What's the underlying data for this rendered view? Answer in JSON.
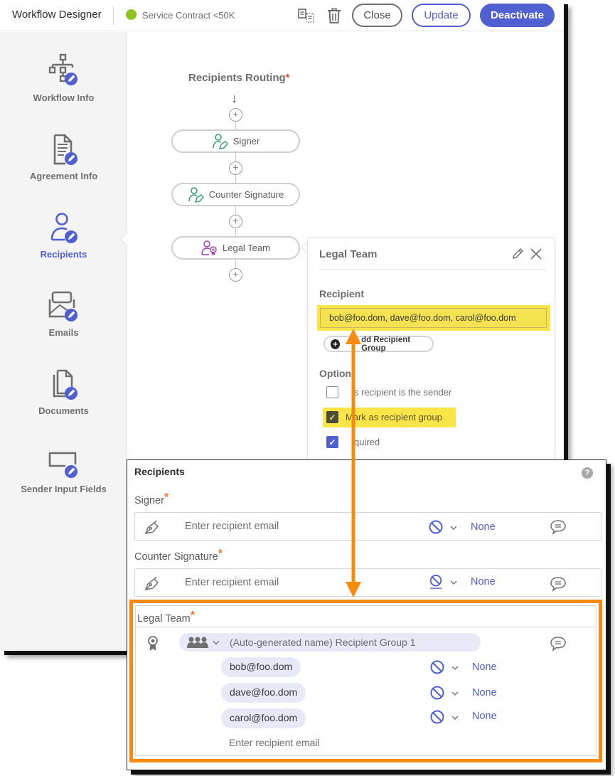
{
  "header": {
    "app_title": "Workflow Designer",
    "workflow_name": "Service Contract <50K",
    "status_color": "#8fc31f",
    "icons": [
      "duplicate-icon",
      "trash-icon"
    ],
    "buttons": {
      "close": "Close",
      "update": "Update",
      "deactivate": "Deactivate"
    }
  },
  "sidebar": {
    "items": [
      {
        "label": "Workflow Info",
        "icon": "workflow-edit-icon",
        "active": false
      },
      {
        "label": "Agreement Info",
        "icon": "document-edit-icon",
        "active": false
      },
      {
        "label": "Recipients",
        "icon": "user-edit-icon",
        "active": true
      },
      {
        "label": "Emails",
        "icon": "email-edit-icon",
        "active": false
      },
      {
        "label": "Documents",
        "icon": "documents-edit-icon",
        "active": false
      },
      {
        "label": "Sender Input Fields",
        "icon": "input-field-edit-icon",
        "active": false
      }
    ]
  },
  "routing": {
    "title": "Recipients Routing",
    "required_mark": "*",
    "arrow": "↓",
    "add_step": "+",
    "nodes": [
      {
        "label": "Signer",
        "icon": "signer-icon",
        "color": "#2d9d78"
      },
      {
        "label": "Counter Signature",
        "icon": "signer-icon",
        "color": "#2d9d78"
      },
      {
        "label": "Legal Team",
        "icon": "approver-icon",
        "color": "#a440b8"
      }
    ]
  },
  "popover": {
    "title": "Legal Team",
    "recipient_label": "Recipient",
    "recipient_value": "bob@foo.dom, dave@foo.dom, carol@foo.dom",
    "add_group_label": "Add Recipient Group",
    "add_group_visible_label": "dd Recipient Group",
    "options_label": "Option",
    "options": [
      {
        "label": "This recipient is the sender",
        "visible_label": "s recipient is the sender",
        "checked": false
      },
      {
        "label": "Mark as recipient group",
        "checked": true,
        "highlighted": true
      },
      {
        "label": "Required",
        "visible_label": "quired",
        "checked": true
      }
    ]
  },
  "recipients_panel": {
    "title": "Recipients",
    "help": "?",
    "email_placeholder": "Enter recipient email",
    "roles": [
      {
        "label": "Signer",
        "required": "*",
        "auth": "None"
      },
      {
        "label": "Counter Signature",
        "required": "*",
        "auth": "None"
      }
    ],
    "legal_team": {
      "label": "Legal Team",
      "required": "*",
      "group_name": "(Auto-generated name) Recipient Group 1",
      "members": [
        {
          "email": "bob@foo.dom",
          "auth": "None"
        },
        {
          "email": "dave@foo.dom",
          "auth": "None"
        },
        {
          "email": "carol@foo.dom",
          "auth": "None"
        }
      ],
      "email_placeholder": "Enter recipient email"
    }
  },
  "annotation": {
    "highlight_color": "#f9e547",
    "arrow_color": "#f58b10"
  }
}
